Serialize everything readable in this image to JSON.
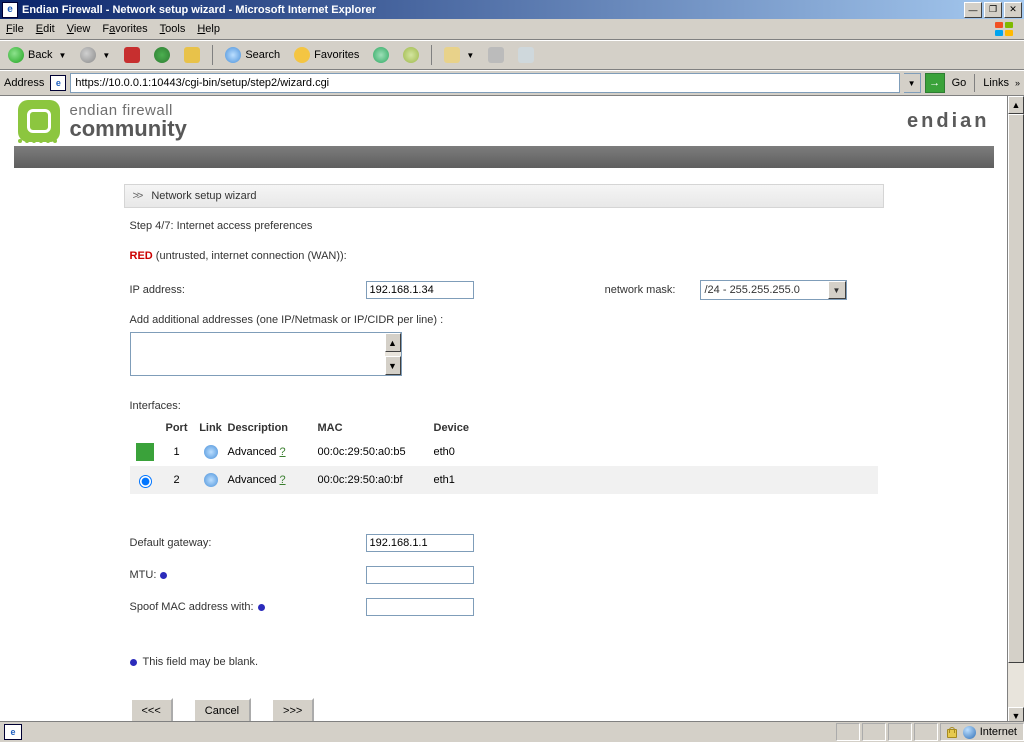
{
  "window": {
    "title": "Endian Firewall - Network setup wizard - Microsoft Internet Explorer"
  },
  "menu": {
    "file": "File",
    "edit": "Edit",
    "view": "View",
    "favorites": "Favorites",
    "tools": "Tools",
    "help": "Help"
  },
  "toolbar": {
    "back": "Back",
    "search": "Search",
    "favorites": "Favorites"
  },
  "address": {
    "label": "Address",
    "url": "https://10.0.0.1:10443/cgi-bin/setup/step2/wizard.cgi",
    "go": "Go",
    "links": "Links"
  },
  "brand": {
    "line1": "endian firewall",
    "line2": "community",
    "right": "endian"
  },
  "panel": {
    "breadcrumb": "Network setup wizard",
    "step": "Step 4/7: Internet access preferences",
    "red_label": "RED",
    "red_desc": " (untrusted, internet connection (WAN)):",
    "ip_label": "IP address:",
    "ip_value": "192.168.1.34",
    "mask_label": "network mask:",
    "mask_value": "/24 - 255.255.255.0",
    "addl_label": "Add additional addresses (one IP/Netmask or IP/CIDR per line) :",
    "iface_label": "Interfaces:",
    "headers": {
      "port": "Port",
      "link": "Link",
      "desc": "Description",
      "mac": "MAC",
      "dev": "Device"
    },
    "rows": [
      {
        "port": "1",
        "desc": "Advanced",
        "mac": "00:0c:29:50:a0:b5",
        "dev": "eth0",
        "selected": "green"
      },
      {
        "port": "2",
        "desc": "Advanced",
        "mac": "00:0c:29:50:a0:bf",
        "dev": "eth1",
        "selected": "radio"
      }
    ],
    "gw_label": "Default gateway:",
    "gw_value": "192.168.1.1",
    "mtu_label": "MTU:",
    "mtu_value": "",
    "spoof_label": "Spoof MAC address with:",
    "spoof_value": "",
    "footnote": "This field may be blank.",
    "btn_back": "<<<",
    "btn_cancel": "Cancel",
    "btn_next": ">>>"
  },
  "status": {
    "zone": "Internet"
  }
}
